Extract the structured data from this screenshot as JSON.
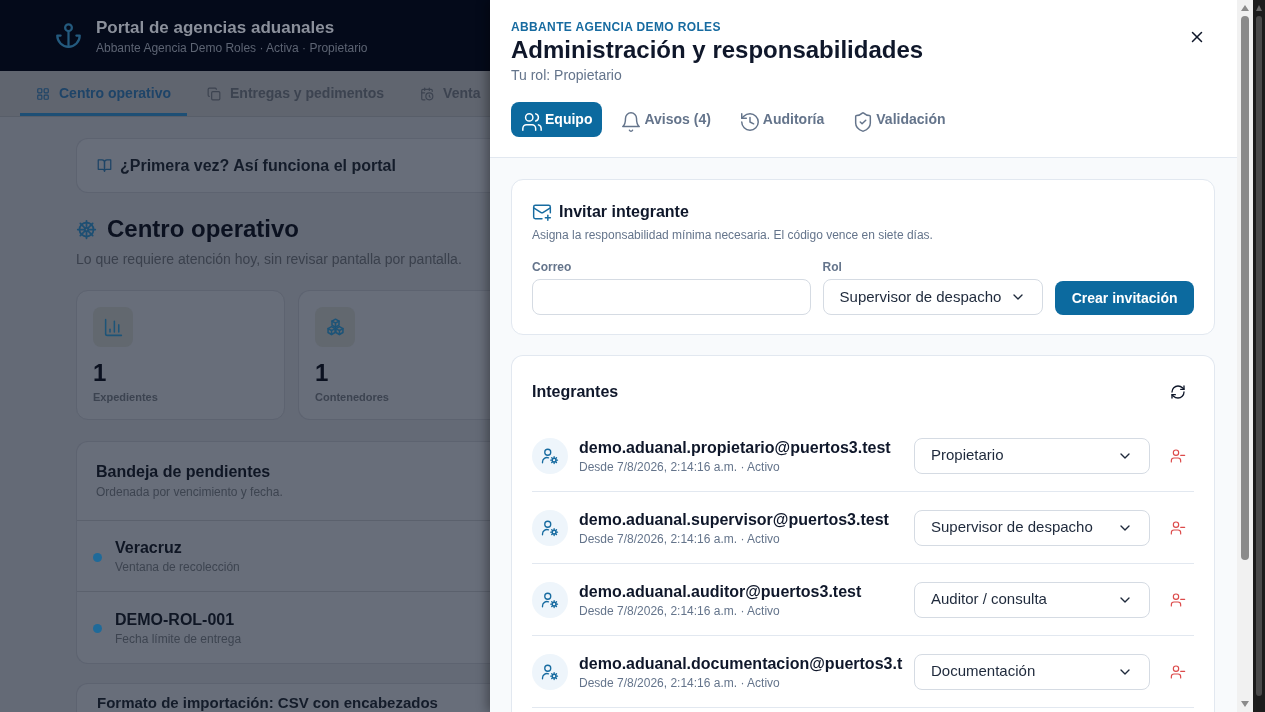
{
  "app_header": {
    "title": "Portal de agencias aduanales",
    "subtitle": "Abbante Agencia Demo Roles · Activa · Propietario"
  },
  "nav_tabs": [
    {
      "label": "Centro operativo",
      "selected": true
    },
    {
      "label": "Entregas y pedimentos",
      "selected": false
    },
    {
      "label": "Venta",
      "selected": false
    }
  ],
  "help_banner": {
    "label": "¿Primera vez? Así funciona el portal"
  },
  "page": {
    "title": "Centro operativo",
    "subtitle": "Lo que requiere atención hoy, sin revisar pantalla por pantalla."
  },
  "stats": [
    {
      "value": "1",
      "label": "Expedientes"
    },
    {
      "value": "1",
      "label": "Contenedores"
    }
  ],
  "inbox": {
    "title": "Bandeja de pendientes",
    "subtitle": "Ordenada por vencimiento y fecha.",
    "items": [
      {
        "title": "Veracruz",
        "subtitle": "Ventana de recolección"
      },
      {
        "title": "DEMO-ROL-001",
        "subtitle": "Fecha límite de entrega"
      }
    ]
  },
  "import_card": {
    "title": "Formato de importación: CSV con encabezados"
  },
  "drawer": {
    "kicker": "ABBANTE AGENCIA DEMO ROLES",
    "title": "Administración y responsabilidades",
    "role": "Tu rol: Propietario",
    "tabs": [
      {
        "label": "Equipo",
        "selected": true
      },
      {
        "label": "Avisos (4)",
        "selected": false
      },
      {
        "label": "Auditoría",
        "selected": false
      },
      {
        "label": "Validación",
        "selected": false
      }
    ]
  },
  "invite": {
    "title": "Invitar integrante",
    "description": "Asigna la responsabilidad mínima necesaria. El código vence en siete días.",
    "email_label": "Correo",
    "role_label": "Rol",
    "role_value": "Supervisor de despacho",
    "button": "Crear invitación"
  },
  "members": {
    "title": "Integrantes",
    "rows": [
      {
        "email": "demo.aduanal.propietario@puertos3.test",
        "meta": "Desde 7/8/2026, 2:14:16 a.m. · Activo",
        "role": "Propietario"
      },
      {
        "email": "demo.aduanal.supervisor@puertos3.test",
        "meta": "Desde 7/8/2026, 2:14:16 a.m. · Activo",
        "role": "Supervisor de despacho"
      },
      {
        "email": "demo.aduanal.auditor@puertos3.test",
        "meta": "Desde 7/8/2026, 2:14:16 a.m. · Activo",
        "role": "Auditor / consulta"
      },
      {
        "email": "demo.aduanal.documentacion@puertos3.t",
        "meta": "Desde 7/8/2026, 2:14:16 a.m. · Activo",
        "role": "Documentación"
      }
    ]
  }
}
